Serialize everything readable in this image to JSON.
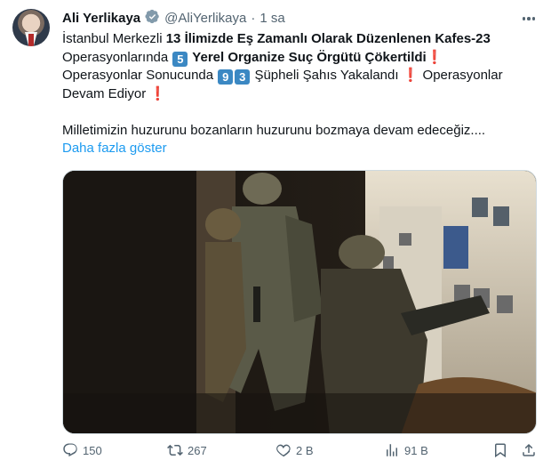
{
  "author": {
    "name": "Ali Yerlikaya",
    "handle": "@AliYerlikaya",
    "separator": "·",
    "time": "1 sa"
  },
  "tweet": {
    "line1_prefix": "İstanbul Merkezli ",
    "line1_bold": "13 İlimizde Eş Zamanlı Olarak Düzenlenen Kafes-23",
    "line2_prefix": "Operasyonlarında ",
    "line2_key": "5",
    "line2_bold": " Yerel Organize Suç Örgütü Çökertildi",
    "line2_excl": "❗",
    "line3_prefix": "Operasyonlar Sonucunda ",
    "line3_key1": "9",
    "line3_key2": "3",
    "line3_text": " Şüpheli Şahıs Yakalandı ",
    "line3_excl": "❗",
    "line3_suffix": " Operasyonlar",
    "line4_text": "Devam Ediyor ",
    "line4_excl": "❗",
    "line5_text": "Milletimizin huzurunu bozanların huzurunu bozmaya devam edeceğiz....",
    "show_more": "Daha fazla göster"
  },
  "actions": {
    "replies": "150",
    "reposts": "267",
    "likes": "2 B",
    "views": "91 B"
  },
  "icons": {
    "verified": "verified-badge-icon",
    "more": "more-dots-icon",
    "reply": "reply-icon",
    "repost": "repost-icon",
    "like": "heart-icon",
    "views": "views-icon",
    "bookmark": "bookmark-icon",
    "share": "share-icon"
  },
  "colors": {
    "text": "#0f1419",
    "secondary": "#536471",
    "link": "#1d9bf0",
    "keycap": "#3b88c3",
    "exclamation": "#dd2e44"
  }
}
